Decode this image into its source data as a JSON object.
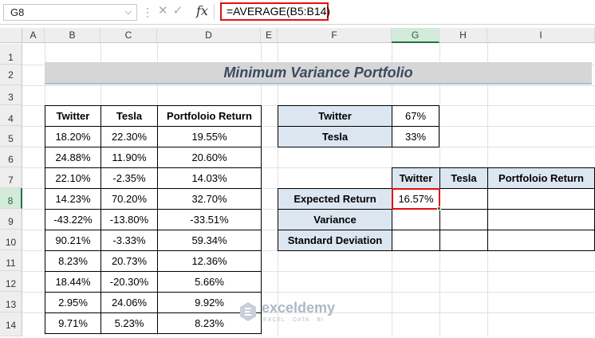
{
  "formula_bar": {
    "name_box": "G8",
    "formula": "=AVERAGE(B5:B14)",
    "fx": "fx"
  },
  "columns": [
    "A",
    "B",
    "C",
    "D",
    "E",
    "F",
    "G",
    "H",
    "I"
  ],
  "selected_column": "G",
  "rows": [
    "1",
    "2",
    "3",
    "4",
    "5",
    "6",
    "7",
    "8",
    "9",
    "10",
    "11",
    "12",
    "13",
    "14"
  ],
  "selected_row": "8",
  "title": "Minimum Variance Portfolio",
  "data_table": {
    "headers": [
      "Twitter",
      "Tesla",
      "Portfoloio Return"
    ],
    "rows": [
      [
        "18.20%",
        "22.30%",
        "19.55%"
      ],
      [
        "24.88%",
        "11.90%",
        "20.60%"
      ],
      [
        "22.10%",
        "-2.35%",
        "14.03%"
      ],
      [
        "14.23%",
        "70.20%",
        "32.70%"
      ],
      [
        "-43.22%",
        "-13.80%",
        "-33.51%"
      ],
      [
        "90.21%",
        "-3.33%",
        "59.34%"
      ],
      [
        "8.23%",
        "20.73%",
        "12.36%"
      ],
      [
        "18.44%",
        "-20.30%",
        "5.66%"
      ],
      [
        "2.95%",
        "24.06%",
        "9.92%"
      ],
      [
        "9.71%",
        "5.23%",
        "8.23%"
      ]
    ]
  },
  "weights": [
    {
      "label": "Twitter",
      "value": "67%"
    },
    {
      "label": "Tesla",
      "value": "33%"
    }
  ],
  "stats_table": {
    "headers": [
      "Twitter",
      "Tesla",
      "Portfoloio Return"
    ],
    "row_labels": [
      "Expected Return",
      "Variance",
      "Standard Deviation"
    ],
    "expected_return_twitter": "16.57%"
  },
  "watermark": {
    "name": "exceldemy",
    "tagline": "EXCEL · DATA · BI"
  }
}
